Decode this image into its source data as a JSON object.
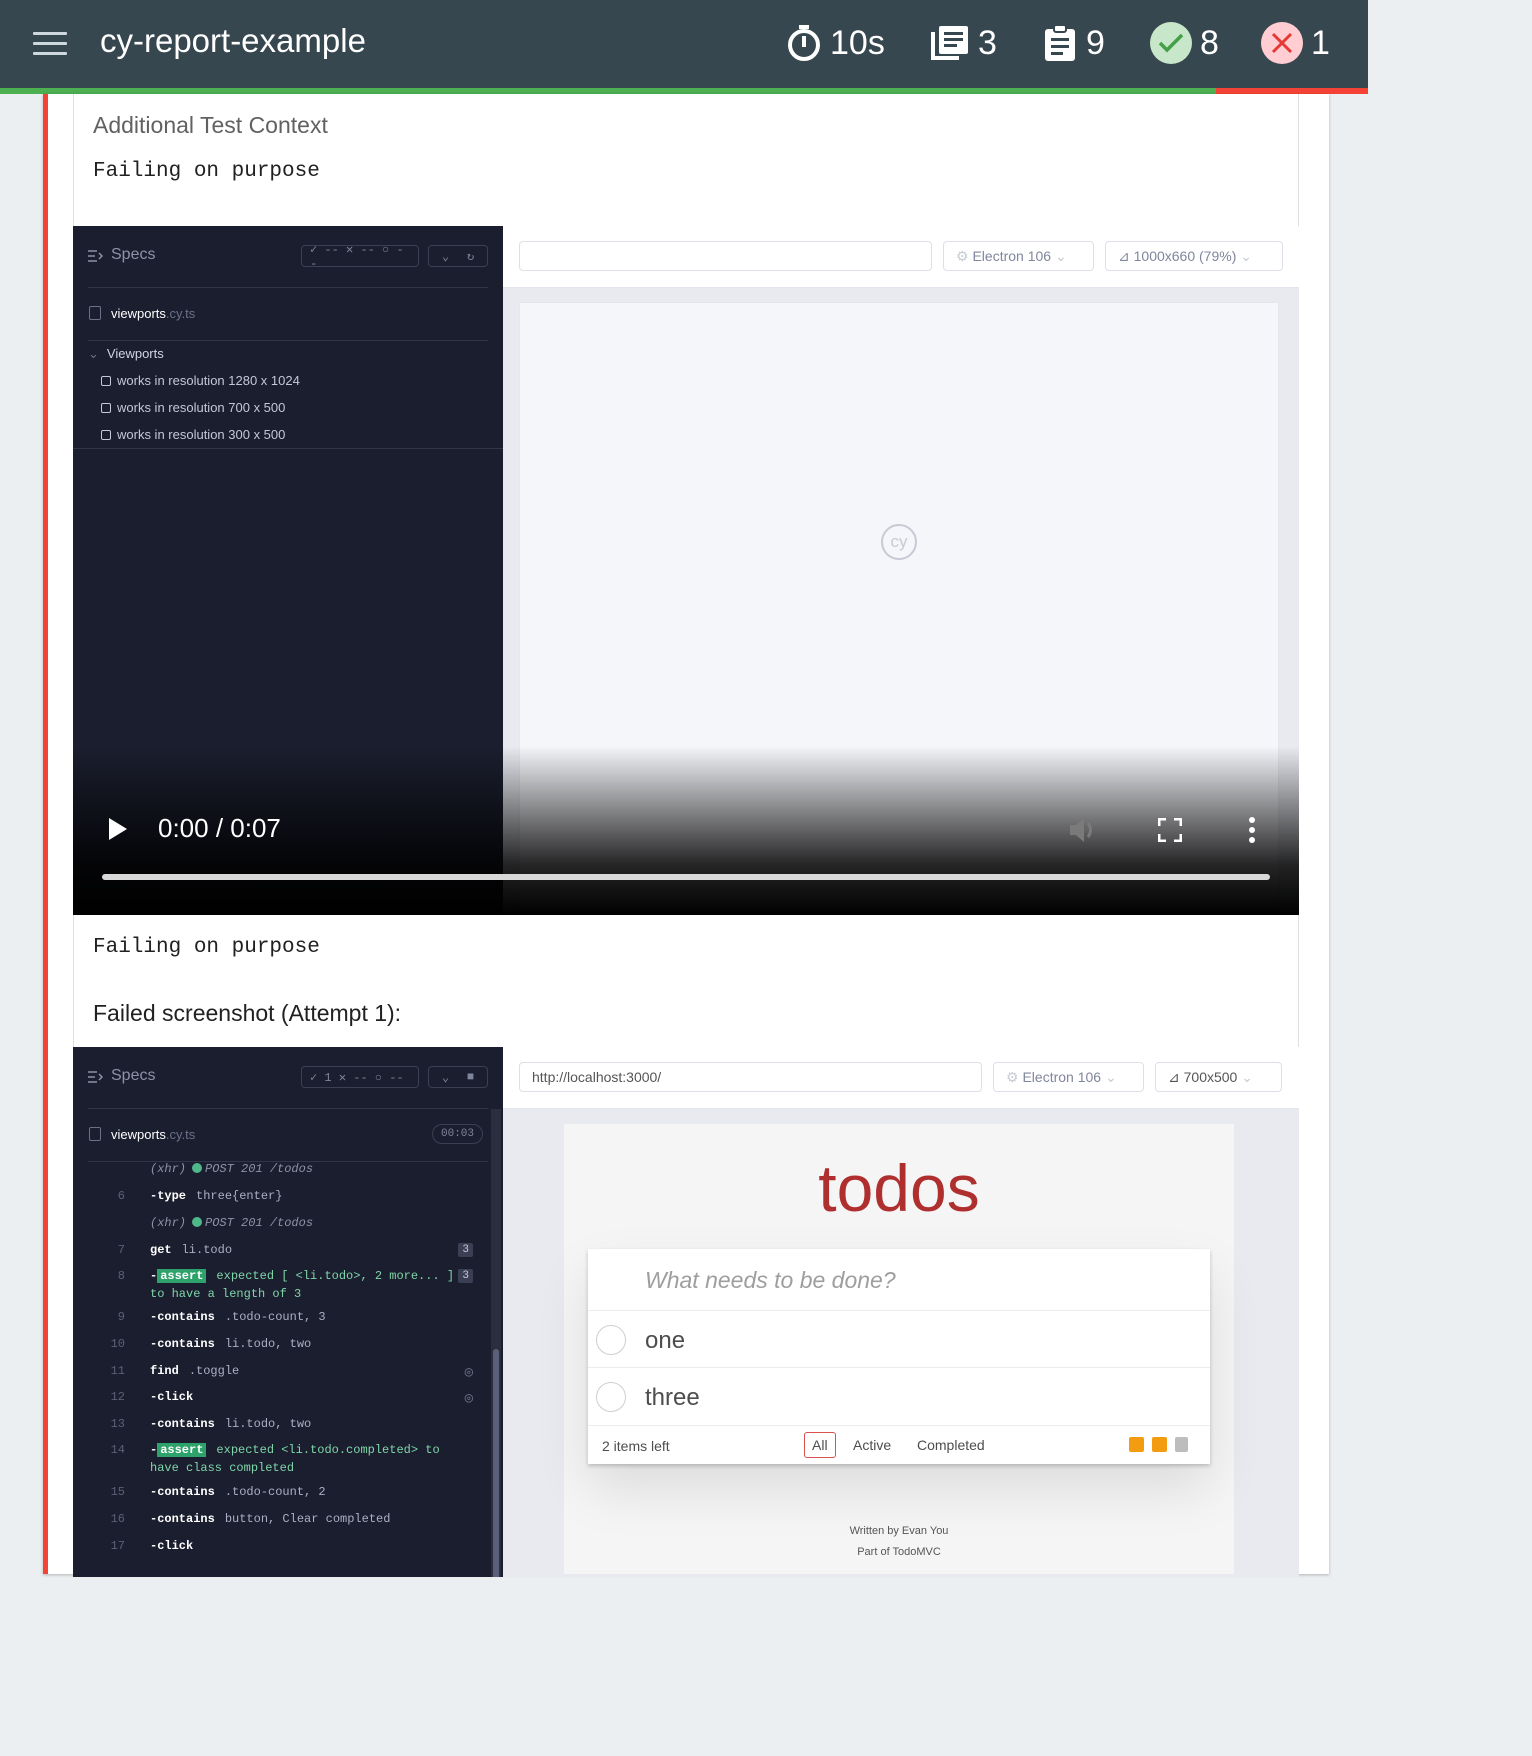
{
  "header": {
    "title": "cy-report-example",
    "duration": "10s",
    "suites": "3",
    "tests": "9",
    "passed": "8",
    "failed": "1"
  },
  "progress": {
    "passed_fraction": 0.889,
    "pass_color": "#4caf50",
    "fail_color": "#f44336"
  },
  "context": {
    "heading": "Additional Test Context",
    "message_top": "Failing on purpose",
    "message_bottom": "Failing on purpose",
    "screenshot_title": "Failed screenshot (Attempt 1):"
  },
  "video": {
    "runner": {
      "specs_label": "Specs",
      "status_pills": "✓ --  ✕ --  ○ --",
      "file_name": "viewports",
      "file_ext": ".cy.ts",
      "suite": "Viewports",
      "tests": [
        "works in resolution 1280 x 1024",
        "works in resolution 700 x 500",
        "works in resolution 300 x 500"
      ]
    },
    "browser_label": "Electron 106",
    "viewport_label": "1000x660  (79%)",
    "url": "",
    "logo_text": "cy",
    "time": "0:00 / 0:07"
  },
  "screenshot": {
    "specs_label": "Specs",
    "status_pills": "✓ 1  ✕ --  ○ --",
    "file_name": "viewports",
    "file_ext": ".cy.ts",
    "file_time": "00:03",
    "url": "http://localhost:3000/",
    "browser_label": "Electron 106",
    "viewport_label": "700x500",
    "commands": [
      {
        "n": "",
        "name": "(xhr)",
        "arg": "POST 201 /todos",
        "kind": "xhr"
      },
      {
        "n": "6",
        "name": "-type",
        "arg": "three{enter}"
      },
      {
        "n": "",
        "name": "(xhr)",
        "arg": "POST 201 /todos",
        "kind": "xhr"
      },
      {
        "n": "7",
        "name": "get",
        "arg": "li.todo",
        "badge": "3"
      },
      {
        "n": "8",
        "name": "-assert",
        "arg": "expected [ <li.todo>, 2 more... ]",
        "arg2": "to have a length of  3",
        "badge": "3",
        "kind": "assert"
      },
      {
        "n": "9",
        "name": "-contains",
        "arg": ".todo-count, 3"
      },
      {
        "n": "10",
        "name": "-contains",
        "arg": "li.todo, two"
      },
      {
        "n": "11",
        "name": "find",
        "arg": ".toggle",
        "eye": true
      },
      {
        "n": "12",
        "name": "-click",
        "arg": "",
        "eye": true
      },
      {
        "n": "13",
        "name": "-contains",
        "arg": "li.todo, two"
      },
      {
        "n": "14",
        "name": "-assert",
        "arg": "expected <li.todo.completed> to",
        "arg2": "have class  completed",
        "kind": "assert"
      },
      {
        "n": "15",
        "name": "-contains",
        "arg": ".todo-count, 2"
      },
      {
        "n": "16",
        "name": "-contains",
        "arg": "button, Clear completed"
      },
      {
        "n": "17",
        "name": "-click",
        "arg": ""
      }
    ],
    "todo": {
      "title": "todos",
      "placeholder": "What needs to be done?",
      "items": [
        "one",
        "three"
      ],
      "count": "2 items left",
      "filters": [
        "All",
        "Active",
        "Completed"
      ],
      "footer_line1": "Written by Evan You",
      "footer_line2": "Part of TodoMVC"
    }
  }
}
